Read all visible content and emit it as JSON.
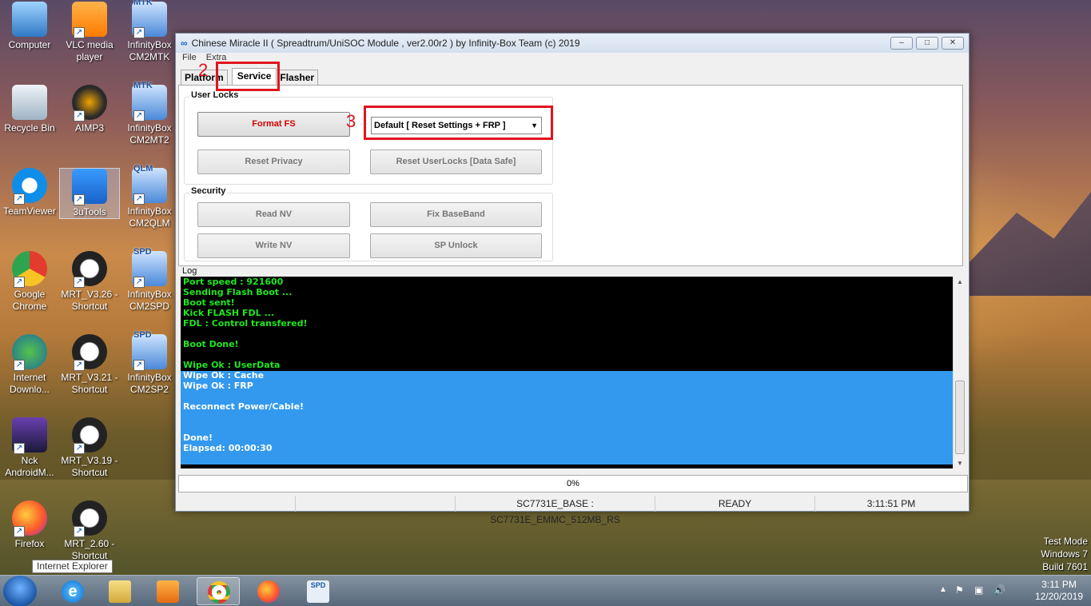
{
  "desktop": {
    "icons": [
      {
        "label": "Computer",
        "icon": "computer-icon"
      },
      {
        "label": "VLC media player",
        "icon": "vlc-icon"
      },
      {
        "label": "InfinityBox CM2MTK",
        "icon": "infinitybox-icon",
        "badge": "MTK"
      },
      {
        "label": "Recycle Bin",
        "icon": "recycle-bin-icon"
      },
      {
        "label": "AIMP3",
        "icon": "aimp-icon"
      },
      {
        "label": "InfinityBox CM2MT2",
        "icon": "infinitybox-icon",
        "badge": "MTK"
      },
      {
        "label": "TeamViewer",
        "icon": "teamviewer-icon"
      },
      {
        "label": "3uTools",
        "icon": "3utools-icon"
      },
      {
        "label": "InfinityBox CM2QLM",
        "icon": "infinitybox-icon",
        "badge": "QLM"
      },
      {
        "label": "Google Chrome",
        "icon": "chrome-icon"
      },
      {
        "label": "MRT_V3.26 - Shortcut",
        "icon": "mrt-icon"
      },
      {
        "label": "InfinityBox CM2SPD",
        "icon": "infinitybox-icon",
        "badge": "SPD"
      },
      {
        "label": "Internet Downlo...",
        "icon": "idm-icon"
      },
      {
        "label": "MRT_V3.21 - Shortcut",
        "icon": "mrt-icon"
      },
      {
        "label": "InfinityBox CM2SP2",
        "icon": "infinitybox-icon",
        "badge": "SPD"
      },
      {
        "label": "Nck AndroidM...",
        "icon": "nck-icon"
      },
      {
        "label": "MRT_V3.19 - Shortcut",
        "icon": "mrt-icon"
      },
      {
        "label": "Firefox",
        "icon": "firefox-icon"
      },
      {
        "label": "MRT_2.60 - Shortcut",
        "icon": "mrt-icon"
      }
    ],
    "tooltip": "Internet Explorer",
    "watermark": [
      "Test Mode",
      "Windows 7",
      "Build 7601"
    ]
  },
  "window": {
    "title": "Chinese Miracle II ( Spreadtrum/UniSOC Module , ver2.00r2  ) by Infinity-Box Team (c) 2019",
    "menu": [
      "File",
      "Extra"
    ],
    "tabs": [
      "Platform",
      "Service",
      "Flasher"
    ],
    "active_tab": "Service",
    "annotations": {
      "tab_marker": "2",
      "combo_marker": "3"
    },
    "user_locks": {
      "title": "User Locks",
      "format_fs": "Format FS",
      "mode_select": "Default [ Reset Settings + FRP ]",
      "reset_privacy": "Reset Privacy",
      "reset_userlocks": "Reset UserLocks [Data Safe]"
    },
    "security": {
      "title": "Security",
      "read_nv": "Read NV",
      "fix_baseband": "Fix BaseBand",
      "write_nv": "Write NV",
      "sp_unlock": "SP Unlock"
    },
    "log": {
      "label": "Log",
      "lines": [
        {
          "text": "Port speed : 921600",
          "style": "green"
        },
        {
          "text": "Sending Flash Boot ...",
          "style": "green"
        },
        {
          "text": "Boot sent!",
          "style": "green"
        },
        {
          "text": "Kick FLASH FDL ...",
          "style": "green"
        },
        {
          "text": "FDL : Control transfered!",
          "style": "green"
        },
        {
          "text": "",
          "style": "green"
        },
        {
          "text": "Boot Done!",
          "style": "green"
        },
        {
          "text": "",
          "style": "green"
        },
        {
          "text": "Wipe Ok : UserData",
          "style": "green"
        },
        {
          "text": "Wipe Ok : Cache",
          "style": "white"
        },
        {
          "text": "Wipe Ok : FRP",
          "style": "white"
        },
        {
          "text": "",
          "style": "white"
        },
        {
          "text": "Reconnect Power/Cable!",
          "style": "white"
        },
        {
          "text": "",
          "style": "white"
        },
        {
          "text": "",
          "style": "white"
        },
        {
          "text": "Done!",
          "style": "white"
        },
        {
          "text": "Elapsed: 00:00:30",
          "style": "white"
        }
      ]
    },
    "progress": "0%",
    "status": {
      "cell1": "",
      "cell2": "",
      "device": "SC7731E_BASE : SC7731E_EMMC_512MB_RS",
      "state": "READY",
      "time": "3:11:51 PM"
    }
  },
  "taskbar": {
    "items": [
      "start-orb",
      "internet-explorer-icon",
      "file-explorer-icon",
      "media-player-icon",
      "chrome-icon",
      "firefox-icon",
      "infinitybox-spd-icon"
    ],
    "active_index": 4,
    "clock_time": "3:11 PM",
    "clock_date": "12/20/2019",
    "spd_badge": "SPD"
  },
  "colors": {
    "accent_red": "#e0141e",
    "log_green": "#1fe61f",
    "log_selection": "#3399ee"
  }
}
